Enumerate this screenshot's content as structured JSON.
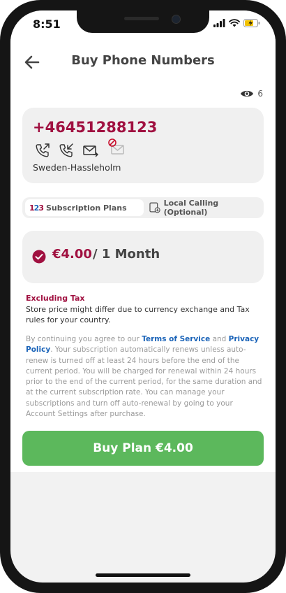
{
  "status_bar": {
    "time": "8:51"
  },
  "header": {
    "title": "Buy Phone Numbers"
  },
  "views": {
    "count": "6"
  },
  "number_card": {
    "number": "+46451288123",
    "region": "Sweden-Hassleholm",
    "capabilities": [
      "outgoing-call-icon",
      "incoming-call-icon",
      "sms-icon",
      "mms-disabled-icon"
    ]
  },
  "tabs": {
    "subscription": "Subscription Plans",
    "local_calling": "Local Calling (Optional)"
  },
  "plan": {
    "price": "€4.00",
    "period": "/ 1 Month"
  },
  "tax": {
    "heading": "Excluding Tax",
    "text": "Store price might differ due to currency exchange and Tax rules for your country."
  },
  "legal": {
    "prefix": "By continuing you agree to our ",
    "terms": "Terms of Service",
    "and": " and ",
    "privacy": "Privacy Policy",
    "body": ". Your subscription automatically renews unless auto-renew is turned off at least 24 hours before the end of the current period. You will be charged for renewal within 24 hours prior to the end of the current period, for the same duration and at the current subscription rate. You can manage your subscriptions and turn off auto-renewal by going to your Account Settings after purchase."
  },
  "buy_button": {
    "label": "Buy Plan €4.00"
  },
  "colors": {
    "accent": "#a01040",
    "buy": "#5cb85c",
    "link": "#1a63b8"
  }
}
